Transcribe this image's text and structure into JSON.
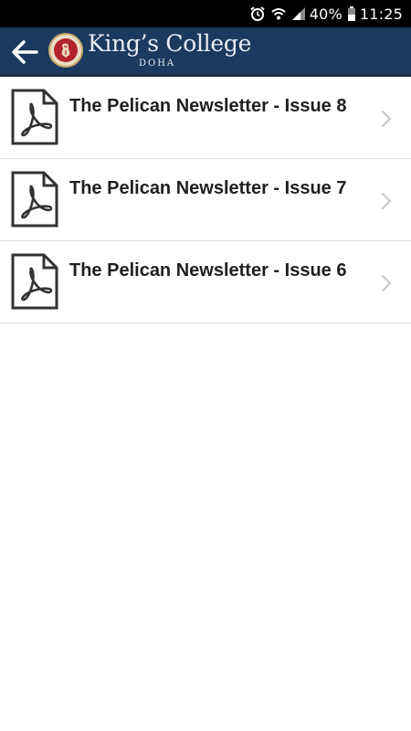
{
  "status_bar": {
    "battery_percent": "40%",
    "time": "11:25",
    "icons": [
      "alarm-icon",
      "wifi-icon",
      "signal-icon",
      "battery-icon"
    ]
  },
  "header": {
    "brand_name": "King’s College",
    "brand_sub": "DOHA",
    "background_color": "#1b3a5e"
  },
  "documents": [
    {
      "title": "The Pelican Newsletter - Issue 8",
      "icon": "pdf-file-icon"
    },
    {
      "title": "The Pelican Newsletter - Issue 7",
      "icon": "pdf-file-icon"
    },
    {
      "title": "The Pelican Newsletter - Issue 6",
      "icon": "pdf-file-icon"
    }
  ]
}
